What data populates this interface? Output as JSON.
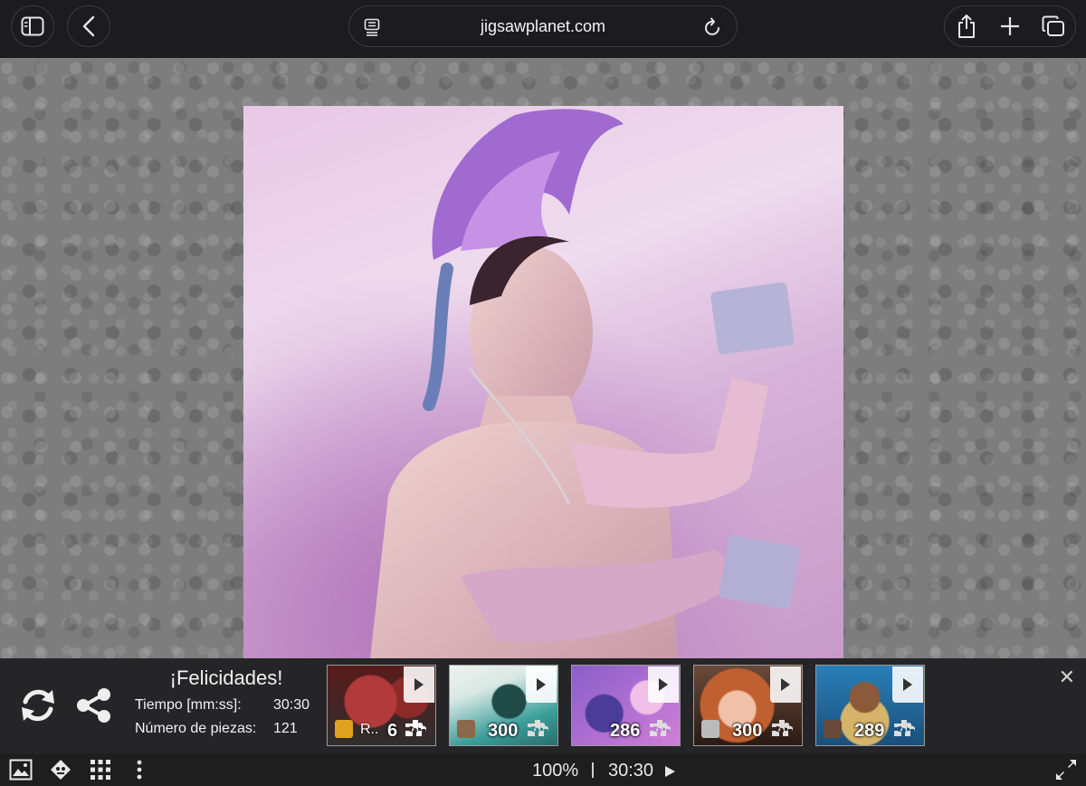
{
  "browser": {
    "url": "jigsawplanet.com",
    "icons": [
      "sidebar-icon",
      "back-icon",
      "reader-icon",
      "reload-icon",
      "share-icon",
      "new-tab-icon",
      "tabs-icon"
    ]
  },
  "completion": {
    "title": "¡Felicidades!",
    "time_label": "Tiempo [mm:ss]:",
    "time_value": "30:30",
    "pieces_label": "Número de piezas:",
    "pieces_value": "121",
    "close_label": "✕"
  },
  "suggestions": [
    {
      "count": "6",
      "label": "R..",
      "colors": [
        "#6b1e1e",
        "#a83232",
        "#3b3b3b"
      ]
    },
    {
      "count": "300",
      "label": "",
      "colors": [
        "#d9e8e4",
        "#3a9e9a",
        "#1f4a46"
      ]
    },
    {
      "count": "286",
      "label": "",
      "colors": [
        "#8a5ec9",
        "#d07fd8",
        "#4c3c9a"
      ]
    },
    {
      "count": "300",
      "label": "",
      "colors": [
        "#5a3020",
        "#c06030",
        "#d9d0c8"
      ]
    },
    {
      "count": "289",
      "label": "",
      "colors": [
        "#2a7fb8",
        "#d5b46a",
        "#1a4f7a"
      ]
    }
  ],
  "status": {
    "zoom": "100%",
    "timer": "30:30"
  },
  "colors": {
    "toolbar": "#1c1c1e",
    "panel": "#262628",
    "board": "#7d7d7d"
  }
}
